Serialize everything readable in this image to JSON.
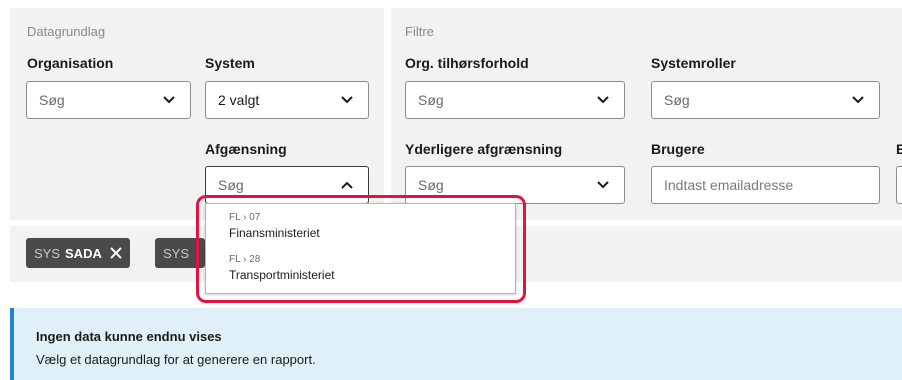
{
  "datagrundlag": {
    "title": "Datagrundlag",
    "organisation": {
      "label": "Organisation",
      "value": "Søg"
    },
    "system": {
      "label": "System",
      "value": "2 valgt"
    },
    "afgraensning": {
      "label": "Afgænsning",
      "value": "Søg"
    }
  },
  "filtre": {
    "title": "Filtre",
    "org_tilhoersforhold": {
      "label": "Org. tilhørsforhold",
      "value": "Søg"
    },
    "systemroller": {
      "label": "Systemroller",
      "value": "Søg"
    },
    "yderligere": {
      "label": "Yderligere afgrænsning",
      "value": "Søg"
    },
    "brugere": {
      "label": "Brugere",
      "placeholder": "Indtast emailadresse"
    },
    "cut_label": "B"
  },
  "chips": [
    {
      "prefix": "SYS",
      "name": "SADA"
    },
    {
      "prefix": "SYS",
      "name": ""
    }
  ],
  "dropdown": {
    "items": [
      {
        "code": "FL › 07",
        "name": "Finansministeriet"
      },
      {
        "code": "FL › 28",
        "name": "Transportministeriet"
      }
    ]
  },
  "info": {
    "title": "Ingen data kunne endnu vises",
    "text": "Vælg et datagrundlag for at generere en rapport."
  },
  "colors": {
    "highlight": "#e0143c",
    "chip_bg": "#4a4a4a",
    "info_bg": "#dff0f9",
    "info_border": "#1e86c7",
    "panel_bg": "#f2f2f2"
  }
}
